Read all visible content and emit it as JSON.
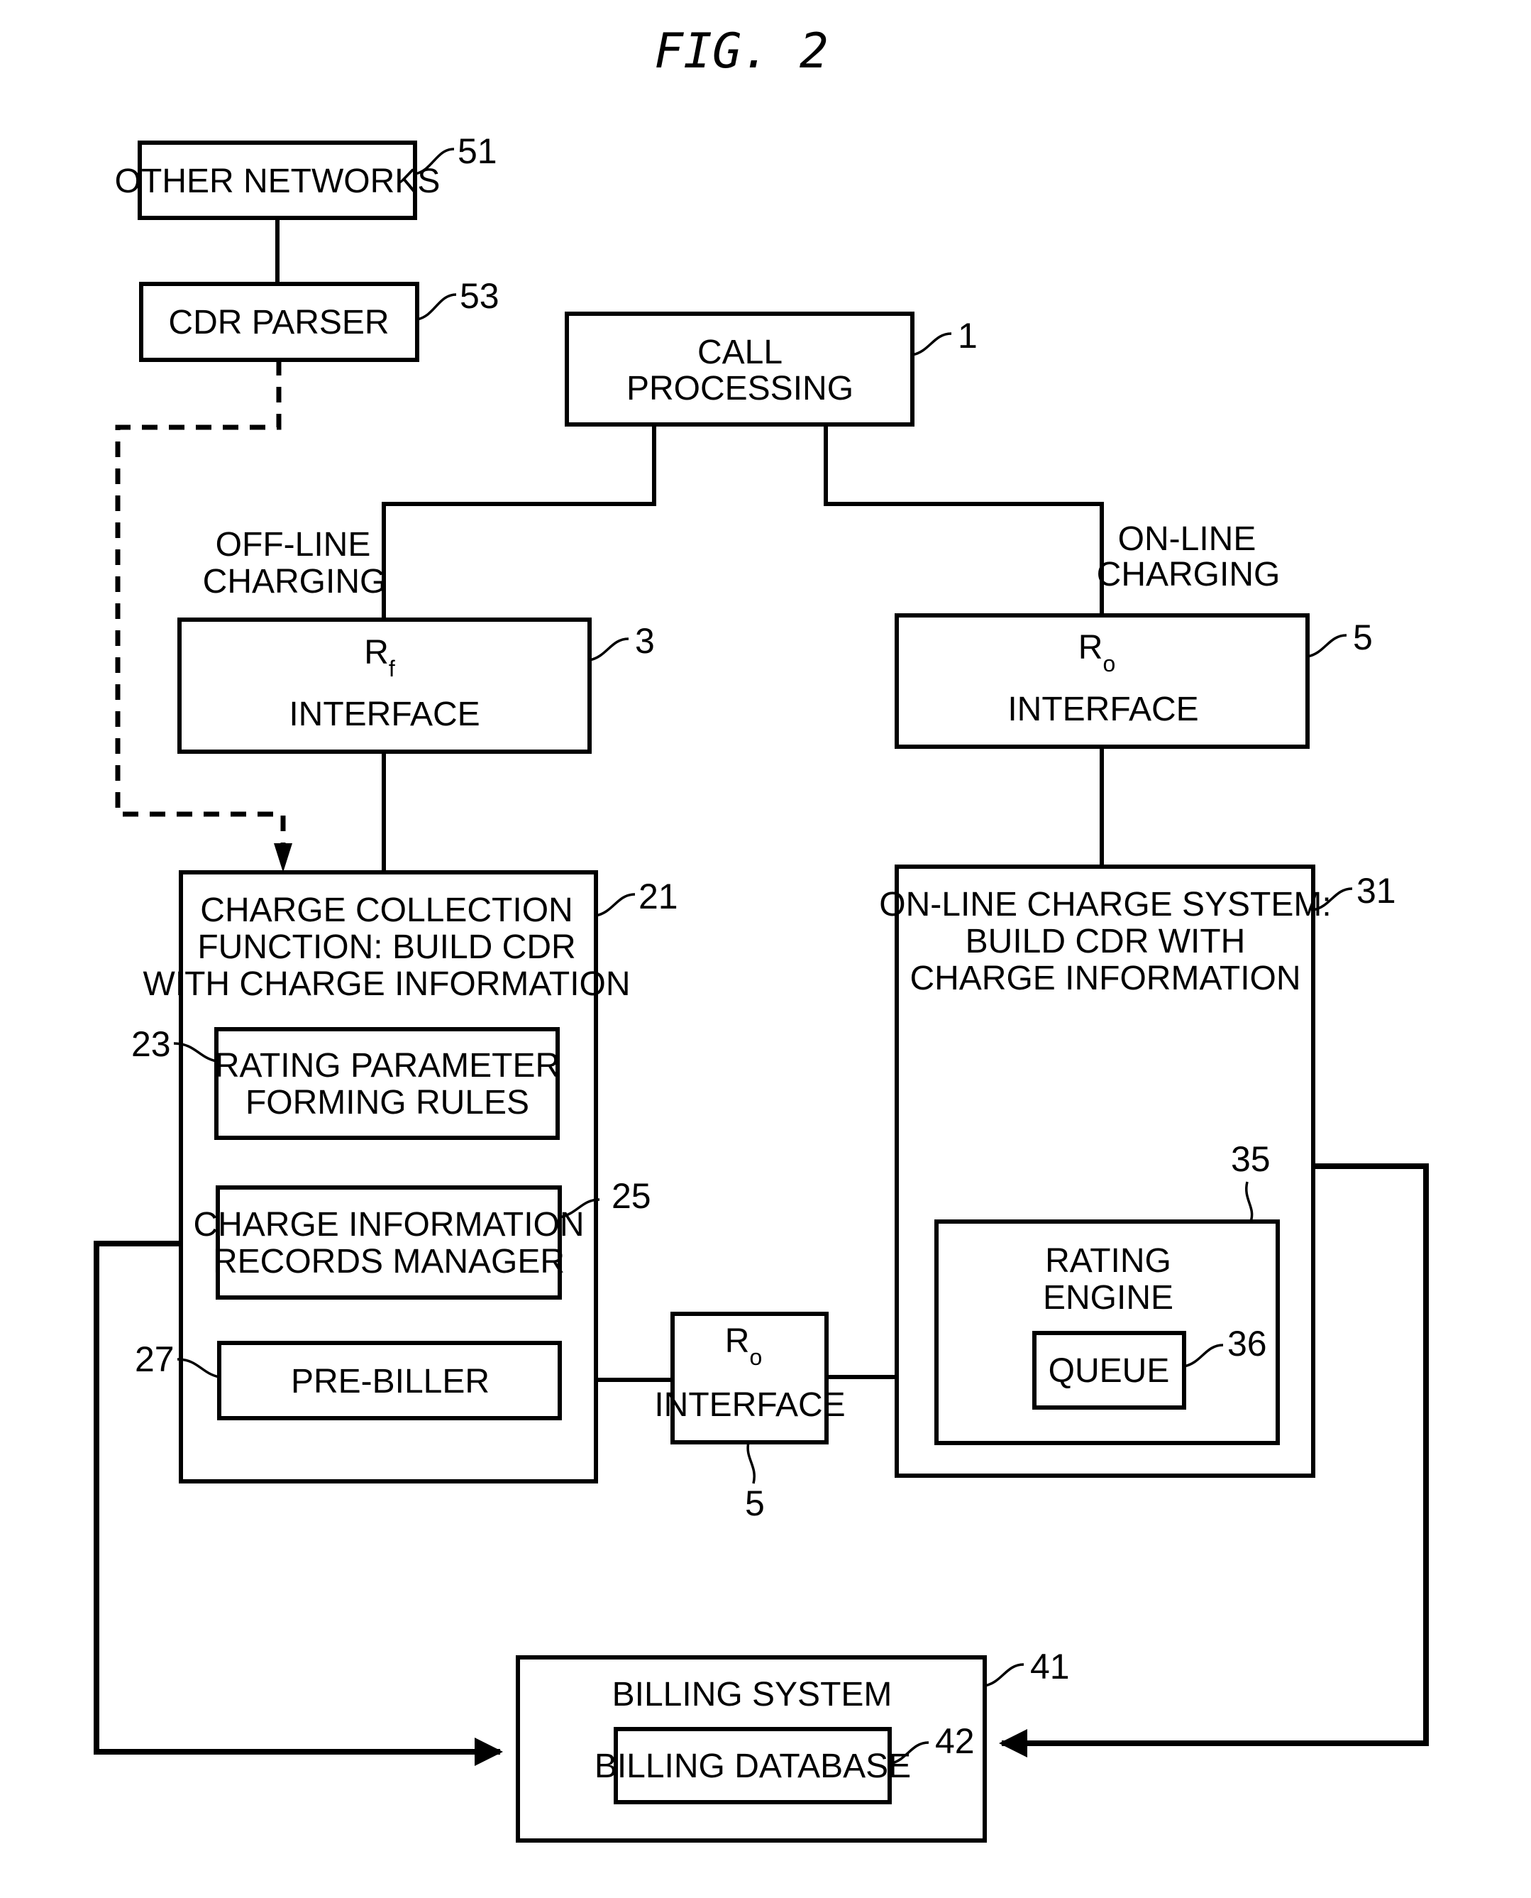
{
  "figure": {
    "title": "FIG. 2"
  },
  "blocks": {
    "other_networks": {
      "label": "OTHER NETWORKS",
      "ref": "51"
    },
    "cdr_parser": {
      "label": "CDR PARSER",
      "ref": "53"
    },
    "call_processing": {
      "lines": [
        "CALL",
        "PROCESSING"
      ],
      "ref": "1"
    },
    "rf_interface": {
      "symbol": "R",
      "subscript": "f",
      "label": "INTERFACE",
      "ref": "3"
    },
    "ro_interface_top": {
      "symbol": "R",
      "subscript": "o",
      "label": "INTERFACE",
      "ref": "5"
    },
    "charge_collection": {
      "lines": [
        "CHARGE COLLECTION",
        "FUNCTION: BUILD CDR",
        "WITH CHARGE INFORMATION"
      ],
      "ref": "21"
    },
    "rating_parameter": {
      "lines": [
        "RATING PARAMETER",
        "FORMING RULES"
      ],
      "ref": "23"
    },
    "charge_info_records": {
      "lines": [
        "CHARGE INFORMATION",
        "RECORDS MANAGER"
      ],
      "ref": "25"
    },
    "pre_biller": {
      "label": "PRE-BILLER",
      "ref": "27"
    },
    "ro_interface_mid": {
      "symbol": "R",
      "subscript": "o",
      "label": "INTERFACE",
      "ref": "5"
    },
    "online_charge_system": {
      "lines": [
        "ON-LINE CHARGE SYSTEM:",
        "BUILD CDR WITH",
        "CHARGE INFORMATION"
      ],
      "ref": "31"
    },
    "rating_engine": {
      "lines": [
        "RATING",
        "ENGINE"
      ],
      "ref": "35"
    },
    "queue": {
      "label": "QUEUE",
      "ref": "36"
    },
    "billing_system": {
      "label": "BILLING SYSTEM",
      "ref": "41"
    },
    "billing_database": {
      "label": "BILLING DATABASE",
      "ref": "42"
    }
  },
  "edge_labels": {
    "offline": [
      "OFF-LINE",
      "CHARGING"
    ],
    "online": [
      "ON-LINE",
      "CHARGING"
    ]
  }
}
